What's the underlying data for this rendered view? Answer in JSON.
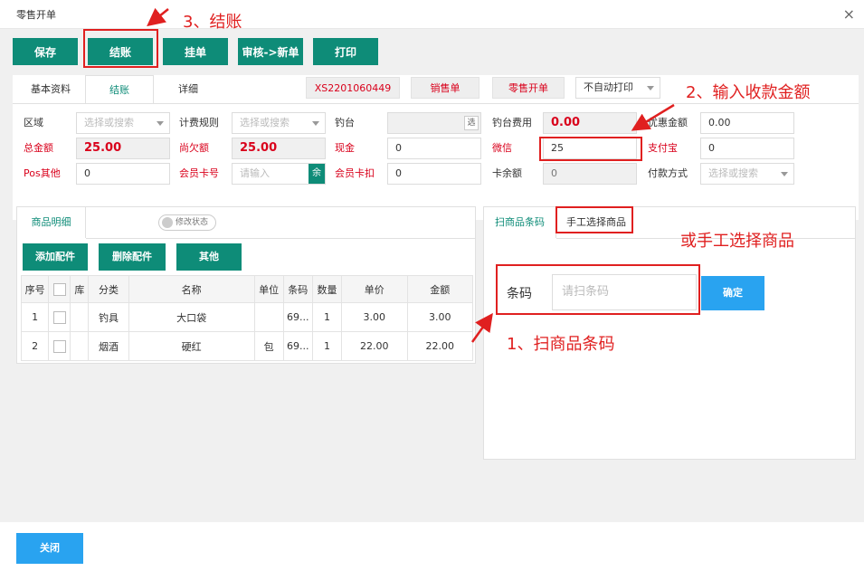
{
  "window": {
    "title": "零售开单",
    "close_glyph": "×"
  },
  "toolbar": {
    "save": "保存",
    "checkout": "结账",
    "hold": "挂单",
    "review_new": "审核->新单",
    "print": "打印"
  },
  "form_tabs": [
    "基本资料",
    "结账",
    "详细"
  ],
  "order": {
    "number": "XS2201060449",
    "sales_order_btn": "销售单",
    "retail_btn": "零售开单",
    "print_mode": "不自动打印"
  },
  "form": {
    "region_label": "区域",
    "region_placeholder": "选择或搜索",
    "billing_rule_label": "计费规则",
    "billing_rule_placeholder": "选择或搜索",
    "fishing_spot_label": "钓台",
    "fishing_spot_badge": "选",
    "fishing_fee_label": "钓台费用",
    "fishing_fee_value": "0.00",
    "discount_label": "优惠金额",
    "discount_value": "0.00",
    "total_label": "总金额",
    "total_value": "25.00",
    "owed_label": "尚欠额",
    "owed_value": "25.00",
    "cash_label": "现金",
    "cash_value": "0",
    "wechat_label": "微信",
    "wechat_value": "25",
    "alipay_label": "支付宝",
    "alipay_value": "0",
    "pos_label": "Pos其他",
    "pos_value": "0",
    "member_card_label": "会员卡号",
    "member_card_placeholder": "请输入",
    "member_balance_badge": "余",
    "member_deduct_label": "会员卡扣",
    "member_deduct_value": "0",
    "card_balance_label": "卡余额",
    "card_balance_value": "0",
    "payment_method_label": "付款方式",
    "payment_method_placeholder": "选择或搜索"
  },
  "left_panel": {
    "tab": "商品明细",
    "toggle_label": "修改状态",
    "buttons": {
      "add": "添加配件",
      "delete": "删除配件",
      "other": "其他"
    },
    "columns": [
      "序号",
      "",
      "库",
      "分类",
      "名称",
      "单位",
      "条码",
      "数量",
      "单价",
      "金额"
    ],
    "rows": [
      {
        "no": "1",
        "stock": "",
        "category": "钓具",
        "name": "大口袋",
        "unit": "",
        "barcode": "69...",
        "qty": "1",
        "price": "3.00",
        "amount": "3.00"
      },
      {
        "no": "2",
        "stock": "",
        "category": "烟酒",
        "name": "硬红",
        "unit": "包",
        "barcode": "69...",
        "qty": "1",
        "price": "22.00",
        "amount": "22.00"
      }
    ]
  },
  "right_panel": {
    "tab_scan": "扫商品条码",
    "tab_manual": "手工选择商品",
    "barcode_label": "条码",
    "barcode_placeholder": "请扫条码",
    "confirm": "确定"
  },
  "footer": {
    "close": "关闭"
  },
  "annotations": {
    "step3": "3、结账",
    "step2": "2、输入收款金额",
    "manual": "或手工选择商品",
    "step1": "1、扫商品条码"
  },
  "colors": {
    "primary": "#0e8c78",
    "blue": "#29a3f0",
    "red": "#d9001b",
    "annotation": "#e02020"
  }
}
